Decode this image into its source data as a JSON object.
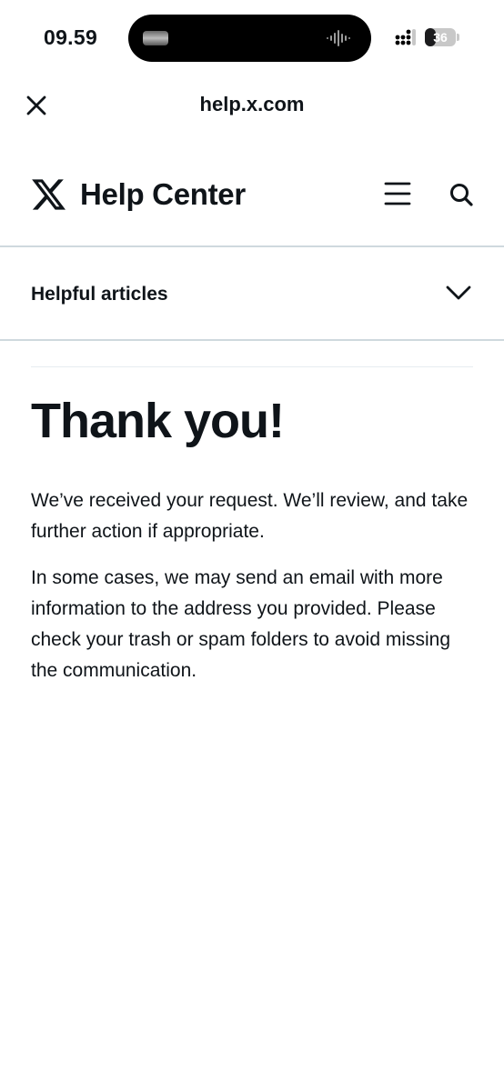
{
  "status_bar": {
    "time": "09.59",
    "battery_level": "36",
    "battery_fraction": 0.36
  },
  "browser": {
    "url": "help.x.com"
  },
  "site_header": {
    "brand_title": "Help Center"
  },
  "helpful_articles": {
    "label": "Helpful articles"
  },
  "main": {
    "title": "Thank you!",
    "paragraph1": "We’ve received your request. We’ll review, and take further action if appropriate.",
    "paragraph2": "In some cases, we may send an email with more information to the address you provided. Please check your trash or spam folders to avoid missing the communication."
  }
}
